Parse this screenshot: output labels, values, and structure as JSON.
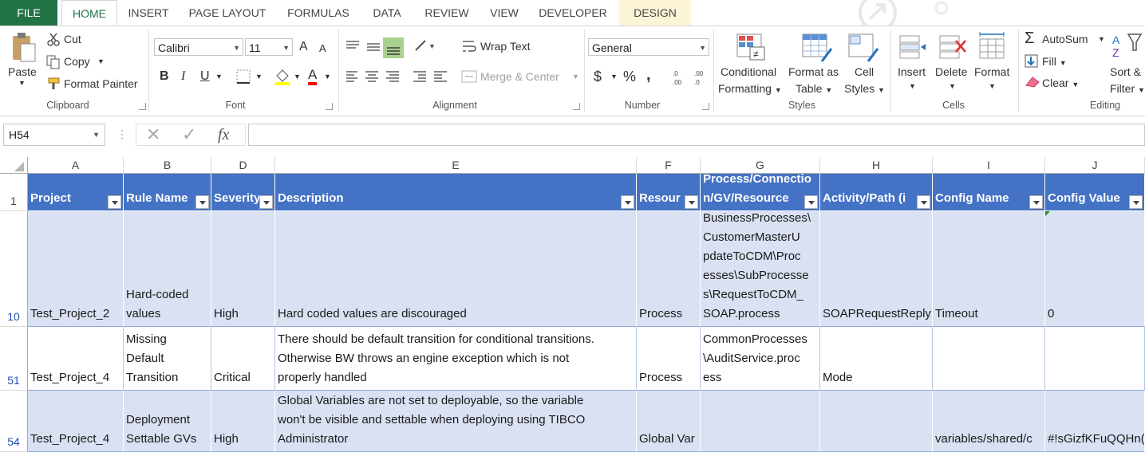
{
  "tabs": {
    "file": "FILE",
    "home": "HOME",
    "insert": "INSERT",
    "page_layout": "PAGE LAYOUT",
    "formulas": "FORMULAS",
    "data": "DATA",
    "review": "REVIEW",
    "view": "VIEW",
    "developer": "DEVELOPER",
    "design": "DESIGN"
  },
  "clipboard": {
    "paste": "Paste",
    "cut": "Cut",
    "copy": "Copy",
    "format_painter": "Format Painter",
    "label": "Clipboard"
  },
  "font": {
    "name": "Calibri",
    "size": "11",
    "label": "Font",
    "bold": "B",
    "italic": "I",
    "underline": "U",
    "grow": "A",
    "shrink": "A",
    "color": "A"
  },
  "alignment": {
    "wrap_text": "Wrap Text",
    "merge_center": "Merge & Center",
    "label": "Alignment"
  },
  "number": {
    "format": "General",
    "currency": "$",
    "percent": "%",
    "comma": ",",
    "label": "Number"
  },
  "styles": {
    "conditional_1": "Conditional",
    "conditional_2": "Formatting",
    "format_table_1": "Format as",
    "format_table_2": "Table",
    "cell_styles_1": "Cell",
    "cell_styles_2": "Styles",
    "label": "Styles"
  },
  "cells": {
    "insert": "Insert",
    "delete": "Delete",
    "format": "Format",
    "label": "Cells"
  },
  "editing": {
    "autosum": "AutoSum",
    "fill": "Fill",
    "clear": "Clear",
    "sort_1": "Sort &",
    "sort_2": "Filter",
    "label": "Editing"
  },
  "formula_bar": {
    "name_box": "H54",
    "fx": "fx",
    "value": ""
  },
  "columns": [
    "A",
    "B",
    "D",
    "E",
    "F",
    "G",
    "H",
    "I",
    "J"
  ],
  "header_row": {
    "row_num": "1",
    "cells": [
      "Project",
      "Rule Name",
      "Severity",
      "Description",
      "Resource",
      "Process/Connection/GV/Resource",
      "Activity/Path (if",
      "Config Name",
      "Config Value"
    ],
    "display": [
      "Project",
      "Rule Name",
      "Severity",
      "Description",
      "Resour",
      "Process/Connectio\nn/GV/Resource",
      "Activity/Path (i",
      "Config Name",
      "Config Value"
    ]
  },
  "rows": [
    {
      "row_num": "10",
      "cells": [
        "Test_Project_2",
        "Hard-coded\nvalues",
        "High",
        "Hard coded values are discouraged",
        "Process",
        "BusinessProcesses\\\nCustomerMasterU\npdateToCDM\\Proc\nesses\\SubProcesse\ns\\RequestToCDM_\nSOAP.process",
        "SOAPRequestReply",
        "Timeout",
        "0"
      ]
    },
    {
      "row_num": "51",
      "cells": [
        "Test_Project_4",
        "Missing\nDefault\nTransition",
        "Critical",
        "There should be default transition for conditional transitions.\nOtherwise BW throws an engine exception which is not\nproperly handled",
        "Process",
        "CommonProcesses\n\\AuditService.proc\ness",
        "Mode",
        "",
        ""
      ]
    },
    {
      "row_num": "54",
      "cells": [
        "Test_Project_4",
        "Deployment\nSettable GVs",
        "High",
        "Global Variables are not set to deployable, so the variable\nwon't be visible and settable when deploying using TIBCO\nAdministrator",
        "Global Var",
        "",
        "",
        "variables/shared/c",
        "#!sGizfKFuQQHn("
      ]
    }
  ]
}
